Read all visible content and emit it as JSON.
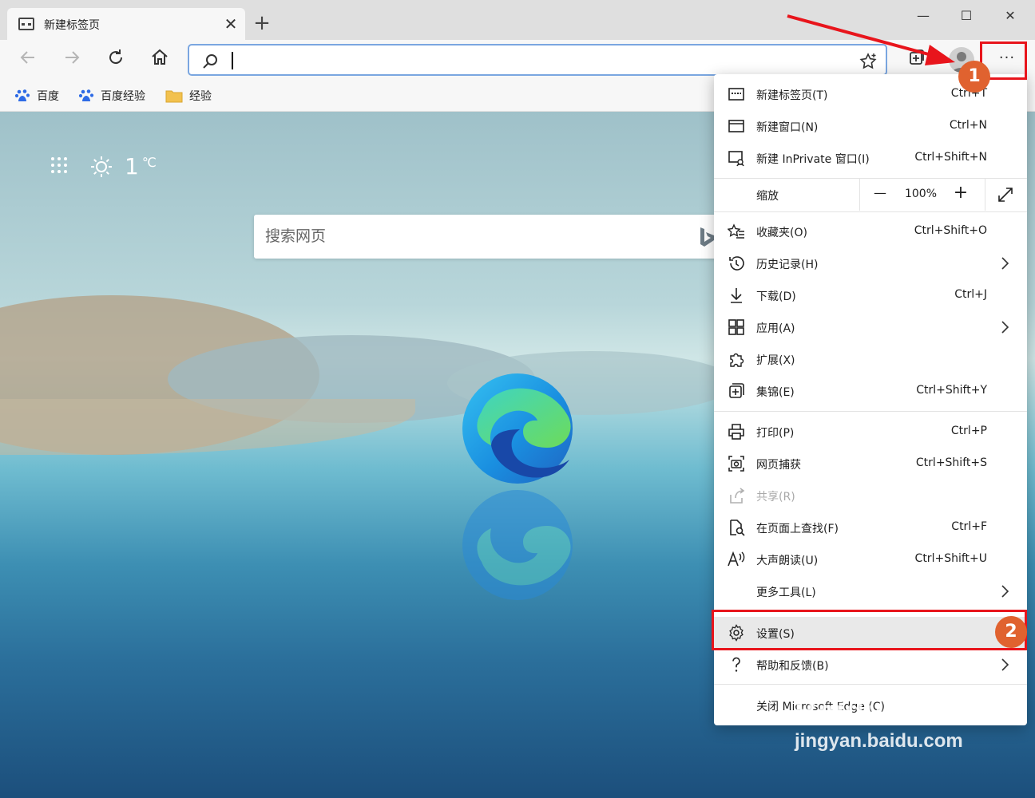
{
  "tab": {
    "title": "新建标签页",
    "close_glyph": "✕",
    "new_glyph": "+"
  },
  "window": {
    "minimize": "—",
    "maximize": "☐",
    "close": "✕"
  },
  "toolbar": {
    "address_value": "",
    "more_glyph": "···"
  },
  "favorites": [
    {
      "label": "百度",
      "icon": "baidu-paw-icon"
    },
    {
      "label": "百度经验",
      "icon": "baidu-paw-icon"
    },
    {
      "label": "经验",
      "icon": "folder-icon"
    }
  ],
  "weather": {
    "temp": "1",
    "unit": "℃"
  },
  "search": {
    "placeholder": "搜索网页"
  },
  "menu": {
    "items": [
      {
        "label": "新建标签页(T)",
        "shortcut": "Ctrl+T"
      },
      {
        "label": "新建窗口(N)",
        "shortcut": "Ctrl+N"
      },
      {
        "label": "新建 InPrivate 窗口(I)",
        "shortcut": "Ctrl+Shift+N"
      },
      {
        "label": "收藏夹(O)",
        "shortcut": "Ctrl+Shift+O"
      },
      {
        "label": "历史记录(H)",
        "shortcut": ""
      },
      {
        "label": "下载(D)",
        "shortcut": "Ctrl+J"
      },
      {
        "label": "应用(A)",
        "shortcut": ""
      },
      {
        "label": "扩展(X)",
        "shortcut": ""
      },
      {
        "label": "集锦(E)",
        "shortcut": "Ctrl+Shift+Y"
      },
      {
        "label": "打印(P)",
        "shortcut": "Ctrl+P"
      },
      {
        "label": "网页捕获",
        "shortcut": "Ctrl+Shift+S"
      },
      {
        "label": "共享(R)",
        "shortcut": ""
      },
      {
        "label": "在页面上查找(F)",
        "shortcut": "Ctrl+F"
      },
      {
        "label": "大声朗读(U)",
        "shortcut": "Ctrl+Shift+U"
      },
      {
        "label": "更多工具(L)",
        "shortcut": ""
      },
      {
        "label": "设置(S)",
        "shortcut": ""
      },
      {
        "label": "帮助和反馈(B)",
        "shortcut": ""
      },
      {
        "label": "关闭 Microsoft Edge (C)",
        "shortcut": ""
      }
    ],
    "zoom": {
      "label": "缩放",
      "value": "100%",
      "minus": "—",
      "plus": "+"
    }
  },
  "annotations": {
    "badge1": "1",
    "badge2": "2"
  },
  "watermark": {
    "brand": "Baidu 经验",
    "url": "jingyan.baidu.com"
  },
  "colors": {
    "accent_red": "#e8151c",
    "badge": "#e0622f",
    "address_border": "#7aa6e0"
  }
}
